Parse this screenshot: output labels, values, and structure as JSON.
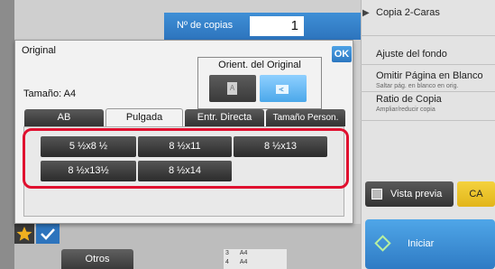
{
  "copies": {
    "label": "Nº de copias",
    "value": "1"
  },
  "right_panel": {
    "items": [
      {
        "title": "Copia 2-Caras",
        "subtitle": ""
      },
      {
        "title": "Ajuste del fondo",
        "subtitle": ""
      },
      {
        "title": "Omitir Página en Blanco",
        "subtitle": "Saltar pág. en blanco en orig."
      },
      {
        "title": "Ratio de Copia",
        "subtitle": "Ampliar/reducir copia"
      }
    ],
    "preview_label": "Vista previa",
    "ca_label": "CA",
    "start_label": "Iniciar"
  },
  "bottom": {
    "otros_label": "Otros",
    "tray_rows": [
      {
        "num": "3",
        "size": "A4"
      },
      {
        "num": "4",
        "size": "A4"
      }
    ]
  },
  "dialog": {
    "title": "Original",
    "ok_label": "OK",
    "size_label": "Tamaño:  A4",
    "orientation": {
      "label": "Orient. del Original",
      "portrait_glyph": "A",
      "landscape_glyph": "A",
      "selected": "landscape"
    },
    "tabs": [
      "AB",
      "Pulgada",
      "Entr. Directa",
      "Tamaño Person."
    ],
    "active_tab": "Pulgada",
    "sizes": [
      "5 ½x8 ½",
      "8 ½x11",
      "8 ½x13",
      "8 ½x13½",
      "8 ½x14"
    ]
  },
  "colors": {
    "accent_blue": "#2d74bd",
    "highlight_red": "#e0102f",
    "ca_yellow": "#e8bd22"
  }
}
